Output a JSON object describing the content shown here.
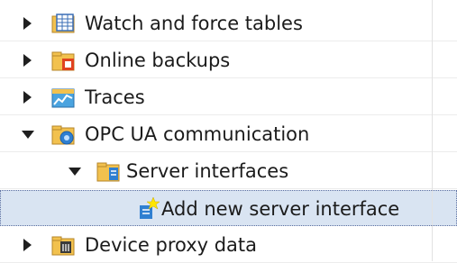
{
  "tree": {
    "items": [
      {
        "label": "Watch and force tables",
        "state": "collapsed",
        "icon": "watch-force-table-icon"
      },
      {
        "label": "Online backups",
        "state": "collapsed",
        "icon": "online-backup-icon"
      },
      {
        "label": "Traces",
        "state": "collapsed",
        "icon": "traces-icon"
      },
      {
        "label": "OPC UA communication",
        "state": "expanded",
        "icon": "opc-ua-icon"
      },
      {
        "label": "Server interfaces",
        "state": "expanded",
        "icon": "server-interface-folder-icon"
      },
      {
        "label": "Add new server interface",
        "state": "leaf",
        "selected": true,
        "icon": "add-new-icon"
      },
      {
        "label": "Device proxy data",
        "state": "collapsed",
        "icon": "device-proxy-icon"
      }
    ]
  },
  "colors": {
    "selection_bg": "#d9e4f2",
    "selection_border": "#5b6fa0",
    "folder_yellow": "#f2c14e",
    "accent_blue": "#2f7fd1"
  }
}
